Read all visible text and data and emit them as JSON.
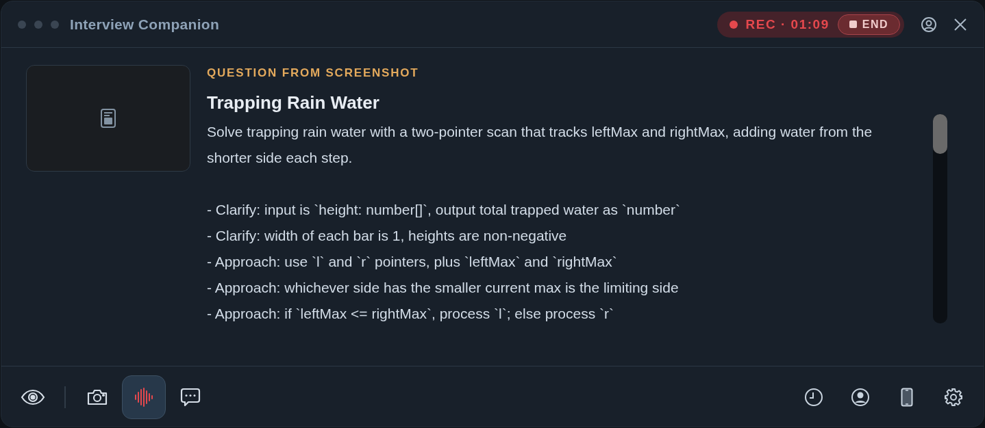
{
  "window": {
    "title": "Interview Companion"
  },
  "recording": {
    "status": "REC · 01:09",
    "end_button": "END"
  },
  "question": {
    "label": "QUESTION FROM SCREENSHOT",
    "title": "Trapping Rain Water",
    "summary": "Solve trapping rain water with a two-pointer scan that tracks leftMax and rightMax, adding water from the shorter side each step.",
    "points": [
      "- Clarify: input is `height: number[]`, output total trapped water as `number`",
      "- Clarify: width of each bar is 1, heights are non-negative",
      "- Approach: use `l` and `r` pointers, plus `leftMax` and `rightMax`",
      "- Approach: whichever side has the smaller current max is the limiting side",
      "- Approach: if `leftMax <= rightMax`, process `l`; else process `r`"
    ]
  },
  "toolbar_left": [
    {
      "kind": "eye",
      "selected": false
    },
    {
      "kind": "camera",
      "selected": false
    },
    {
      "kind": "audio",
      "selected": true
    },
    {
      "kind": "chat",
      "selected": false
    }
  ],
  "toolbar_right": [
    {
      "kind": "history",
      "selected": false
    },
    {
      "kind": "profile",
      "selected": false
    },
    {
      "kind": "phone",
      "selected": false
    },
    {
      "kind": "settings",
      "selected": false
    }
  ]
}
